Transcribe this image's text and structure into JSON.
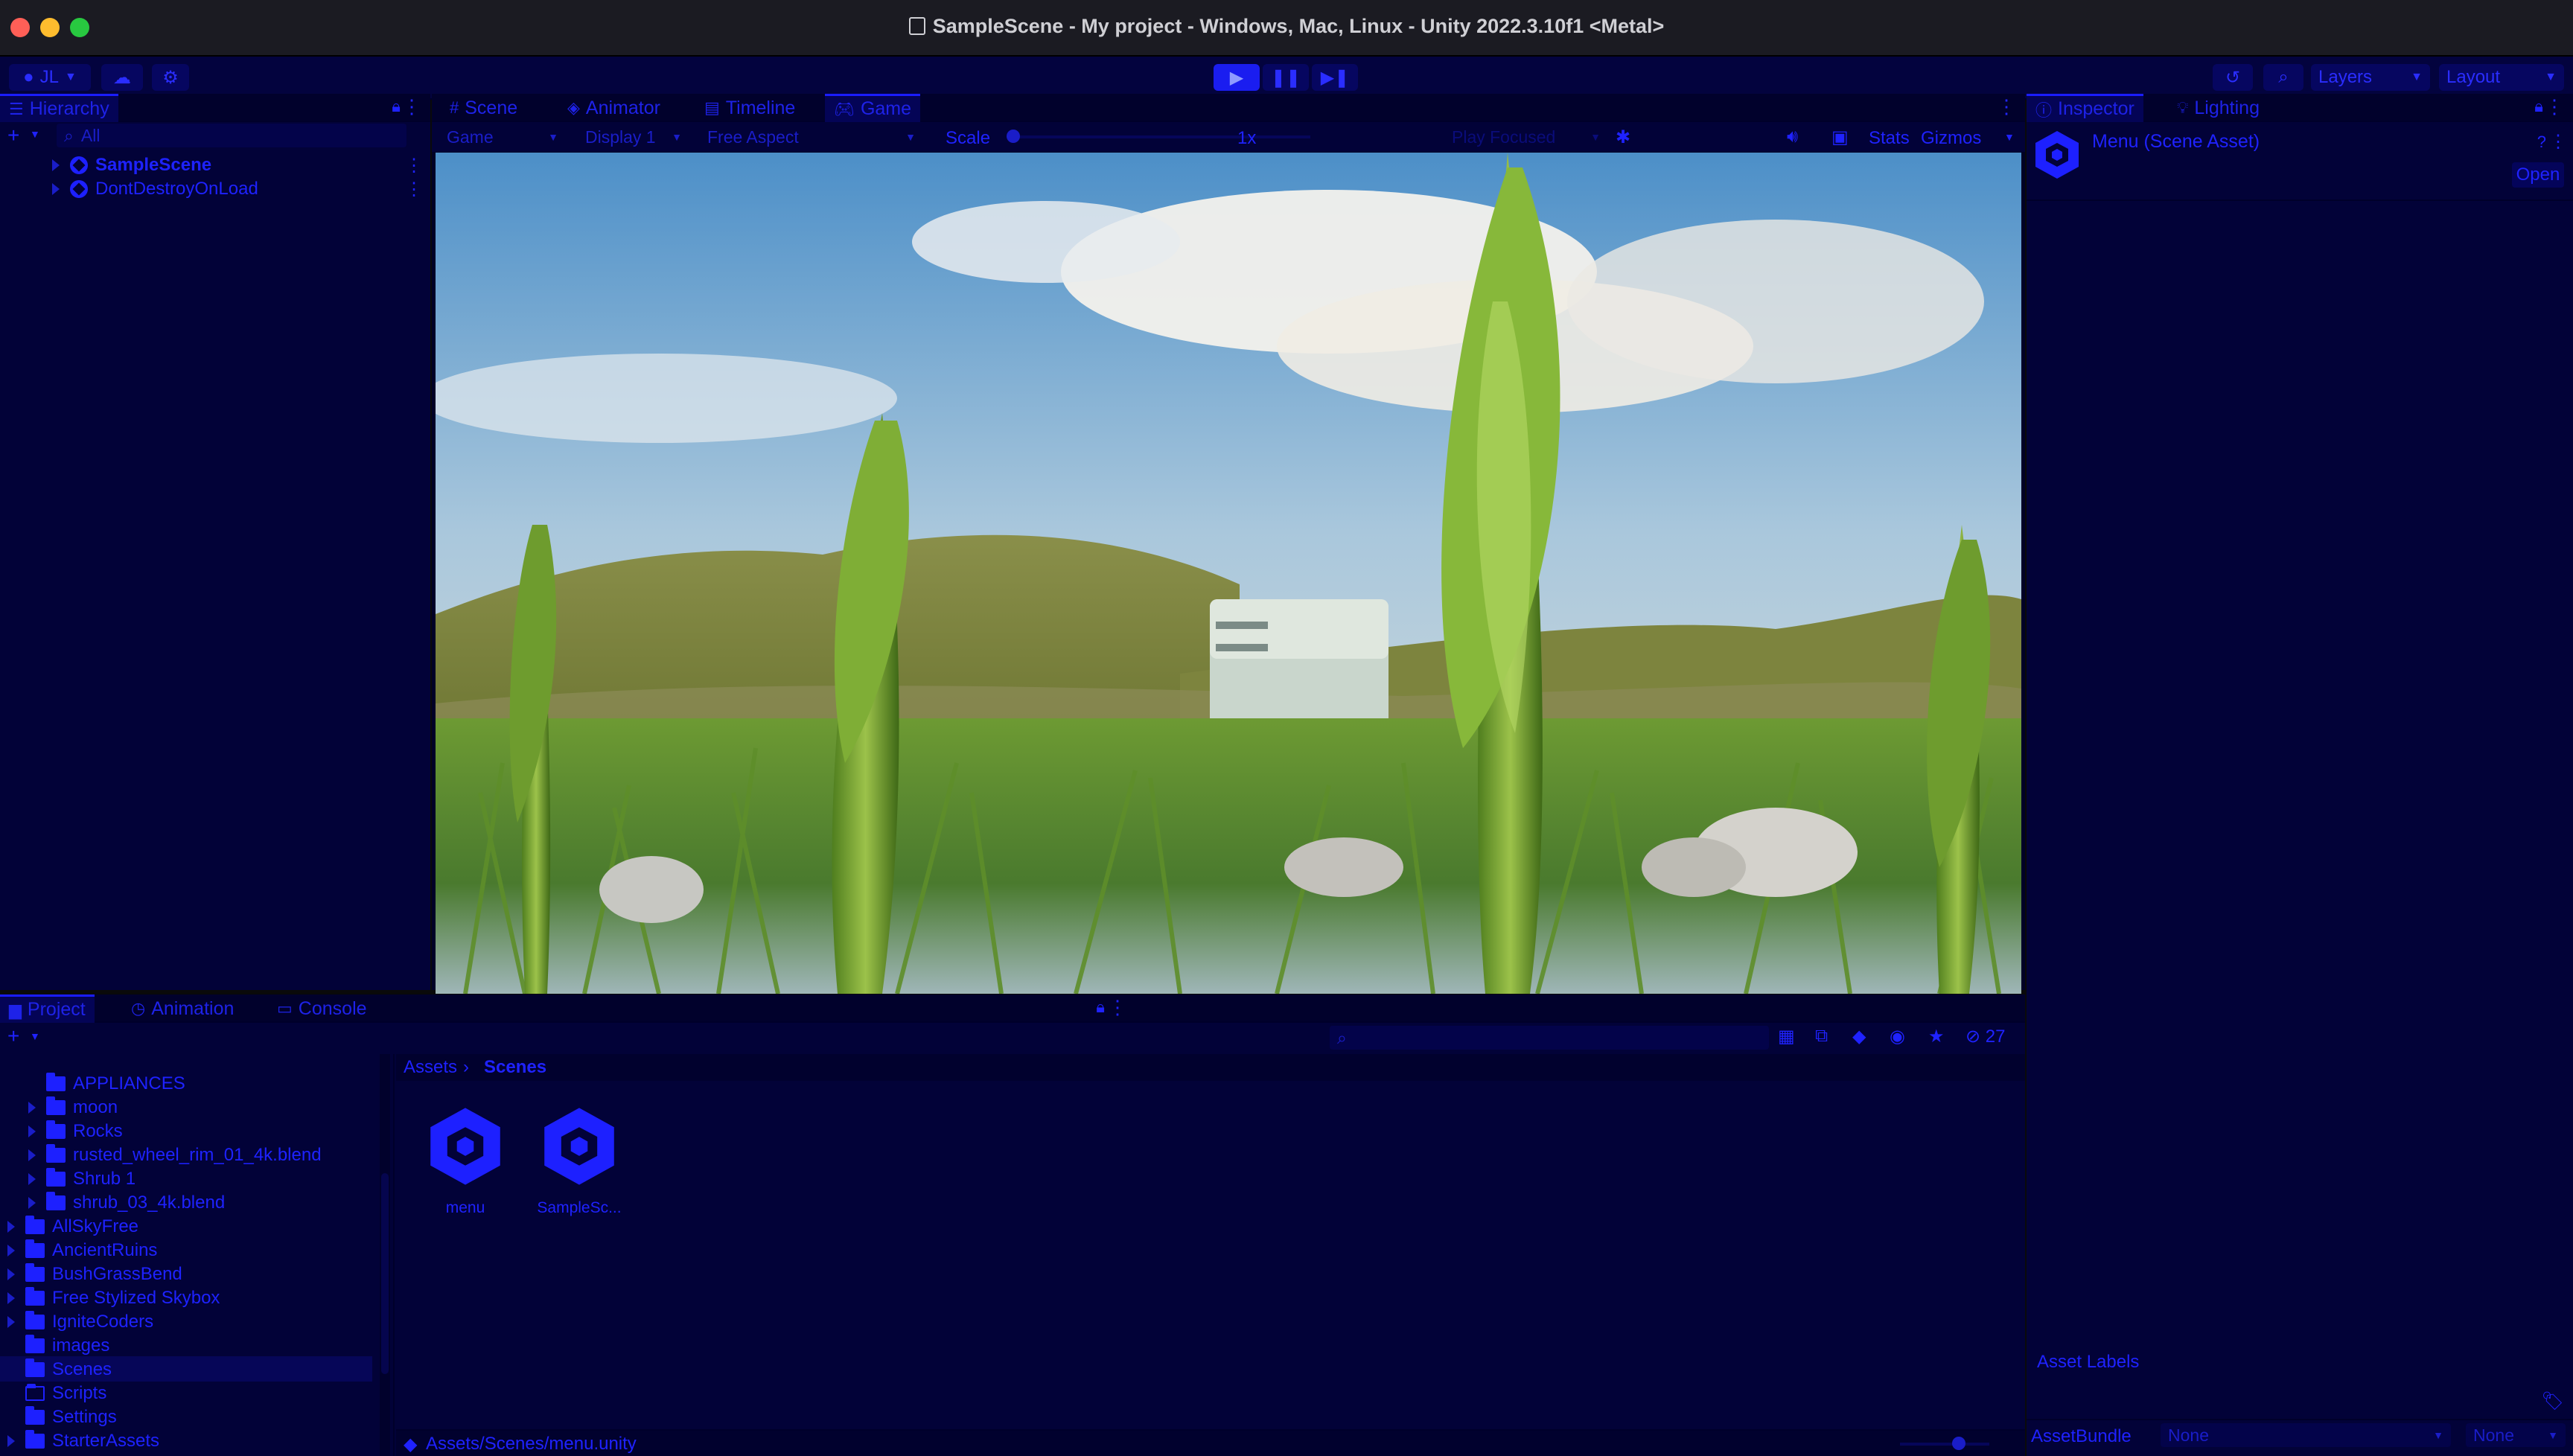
{
  "window": {
    "title": "SampleScene - My project - Windows, Mac, Linux - Unity 2022.3.10f1 <Metal>",
    "traffic_lights": {
      "close": "#ff5f57",
      "minimize": "#febc2e",
      "maximize": "#28c840"
    }
  },
  "toolbar": {
    "account_label": "JL",
    "play_icon": "play-icon",
    "pause_icon": "pause-icon",
    "step_icon": "step-icon",
    "layers_label": "Layers",
    "layout_label": "Layout"
  },
  "hierarchy": {
    "tab_label": "Hierarchy",
    "search_placeholder": "All",
    "items": [
      {
        "label": "SampleScene"
      },
      {
        "label": "DontDestroyOnLoad"
      }
    ]
  },
  "center_tabs": [
    {
      "label": "Scene"
    },
    {
      "label": "Animator"
    },
    {
      "label": "Timeline"
    },
    {
      "label": "Game"
    }
  ],
  "game_toolbar": {
    "mode": "Game",
    "display": "Display 1",
    "aspect": "Free Aspect",
    "scale_label": "Scale",
    "scale_value": "1x",
    "play_mode": "Play Focused",
    "stats_label": "Stats",
    "gizmos_label": "Gizmos"
  },
  "inspector": {
    "tabs": [
      {
        "label": "Inspector"
      },
      {
        "label": "Lighting"
      }
    ],
    "asset_title": "Menu (Scene Asset)",
    "open_button": "Open",
    "asset_labels": "Asset Labels",
    "assetbundle_label": "AssetBundle",
    "assetbundle_value": "None",
    "variant_value": "None"
  },
  "bottom_tabs": [
    {
      "label": "Project"
    },
    {
      "label": "Animation"
    },
    {
      "label": "Console"
    }
  ],
  "project": {
    "hidden_count": "27",
    "tree": [
      {
        "label": "APPLIANCES",
        "depth": 2,
        "arrow": false
      },
      {
        "label": "moon",
        "depth": 2,
        "arrow": true
      },
      {
        "label": "Rocks",
        "depth": 2,
        "arrow": true
      },
      {
        "label": "rusted_wheel_rim_01_4k.blend",
        "depth": 2,
        "arrow": true
      },
      {
        "label": "Shrub 1",
        "depth": 2,
        "arrow": true
      },
      {
        "label": "shrub_03_4k.blend",
        "depth": 2,
        "arrow": true
      },
      {
        "label": "AllSkyFree",
        "depth": 1,
        "arrow": true
      },
      {
        "label": "AncientRuins",
        "depth": 1,
        "arrow": true
      },
      {
        "label": "BushGrassBend",
        "depth": 1,
        "arrow": true
      },
      {
        "label": "Free Stylized Skybox",
        "depth": 1,
        "arrow": true
      },
      {
        "label": "IgniteCoders",
        "depth": 1,
        "arrow": true
      },
      {
        "label": "images",
        "depth": 1,
        "arrow": false
      },
      {
        "label": "Scenes",
        "depth": 1,
        "arrow": false,
        "selected": true
      },
      {
        "label": "Scripts",
        "depth": 1,
        "arrow": false,
        "outline": true
      },
      {
        "label": "Settings",
        "depth": 1,
        "arrow": false
      },
      {
        "label": "StarterAssets",
        "depth": 1,
        "arrow": true
      }
    ],
    "breadcrumb": [
      "Assets",
      "Scenes"
    ],
    "files": [
      {
        "label": "menu"
      },
      {
        "label": "SampleSc..."
      }
    ],
    "status_path": "Assets/Scenes/menu.unity"
  },
  "colors": {
    "panel_bg": "#020238",
    "accent": "#1d20ff",
    "text": "#1e22ff"
  }
}
